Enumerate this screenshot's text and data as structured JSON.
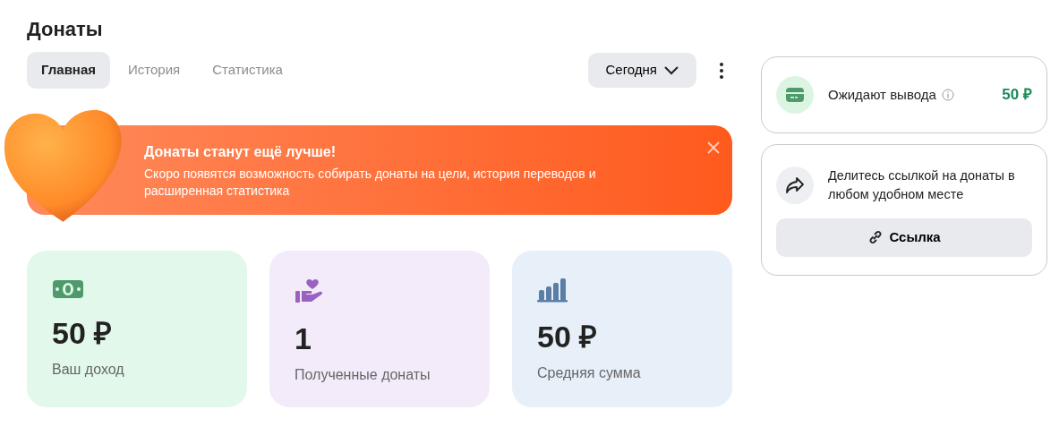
{
  "page_title": "Донаты",
  "tabs": [
    {
      "label": "Главная",
      "selected": true
    },
    {
      "label": "История",
      "selected": false
    },
    {
      "label": "Статистика",
      "selected": false
    }
  ],
  "period_dropdown": {
    "value": "Сегодня"
  },
  "banner": {
    "title": "Донаты станут ещё лучше!",
    "text": "Скоро появятся возможность собирать донаты на цели, история переводов и расширенная статистика"
  },
  "stats": [
    {
      "kind": "income",
      "value": "50 ₽",
      "label": "Ваш доход"
    },
    {
      "kind": "donations",
      "value": "1",
      "label": "Полученные донаты"
    },
    {
      "kind": "average",
      "value": "50 ₽",
      "label": "Средняя сумма"
    }
  ],
  "pending": {
    "label": "Ожидают вывода",
    "amount": "50 ₽"
  },
  "share": {
    "text": "Делитесь ссылкой на донаты в любом удобном месте",
    "button": "Ссылка"
  }
}
